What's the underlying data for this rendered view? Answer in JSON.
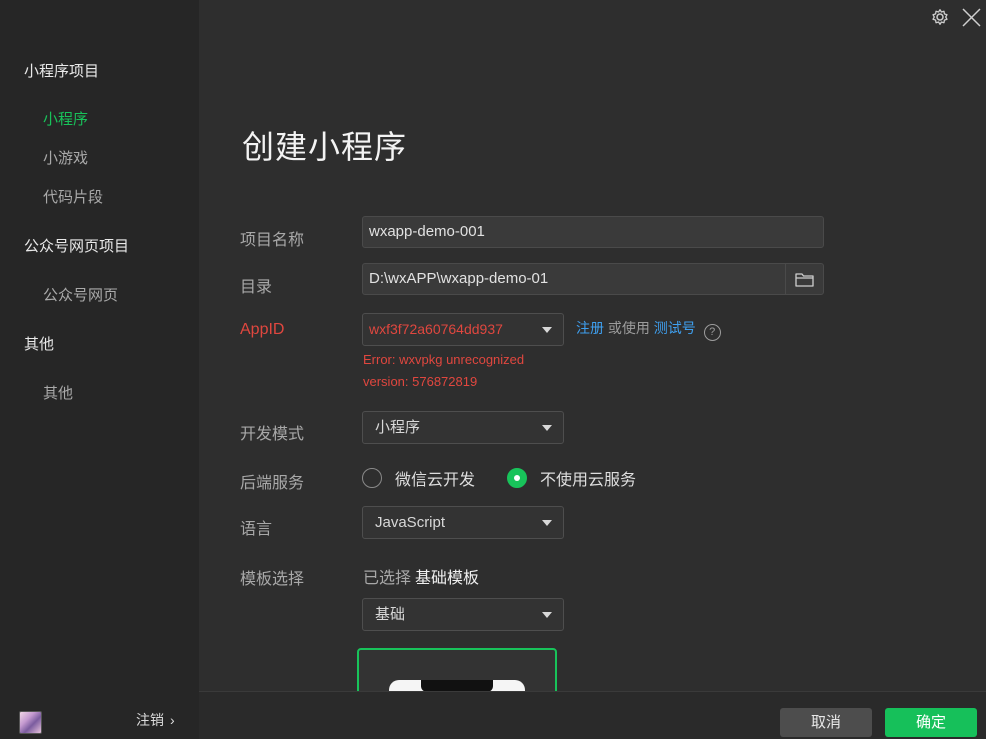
{
  "sidebar": {
    "sections": [
      {
        "title": "小程序项目",
        "items": [
          "小程序",
          "小游戏",
          "代码片段"
        ]
      },
      {
        "title": "公众号网页项目",
        "items": [
          "公众号网页"
        ]
      },
      {
        "title": "其他",
        "items": [
          "其他"
        ]
      }
    ],
    "active_item": "小程序",
    "logout_label": "注销",
    "logout_chevron": "›"
  },
  "form": {
    "title": "创建小程序",
    "project_name": {
      "label": "项目名称",
      "value": "wxapp-demo-001"
    },
    "directory": {
      "label": "目录",
      "value": "D:\\wxAPP\\wxapp-demo-01"
    },
    "appid": {
      "label": "AppID",
      "value": "wxf3f72a60764dd937",
      "error_line1": "Error: wxvpkg unrecognized",
      "error_line2": "version: 576872819",
      "register_link": "注册",
      "or_use": "或使用",
      "test_link": "测试号",
      "help": "?"
    },
    "dev_mode": {
      "label": "开发模式",
      "value": "小程序"
    },
    "backend": {
      "label": "后端服务",
      "option1": "微信云开发",
      "option2": "不使用云服务",
      "selected": "不使用云服务"
    },
    "language": {
      "label": "语言",
      "value": "JavaScript"
    },
    "template": {
      "label": "模板选择",
      "selected_prefix": "已选择",
      "selected_name": "基础模板",
      "category": "基础"
    }
  },
  "footer": {
    "cancel": "取消",
    "confirm": "确定"
  },
  "colors": {
    "accent": "#18c35a",
    "error": "#e0473f",
    "link": "#3fa0f0"
  }
}
